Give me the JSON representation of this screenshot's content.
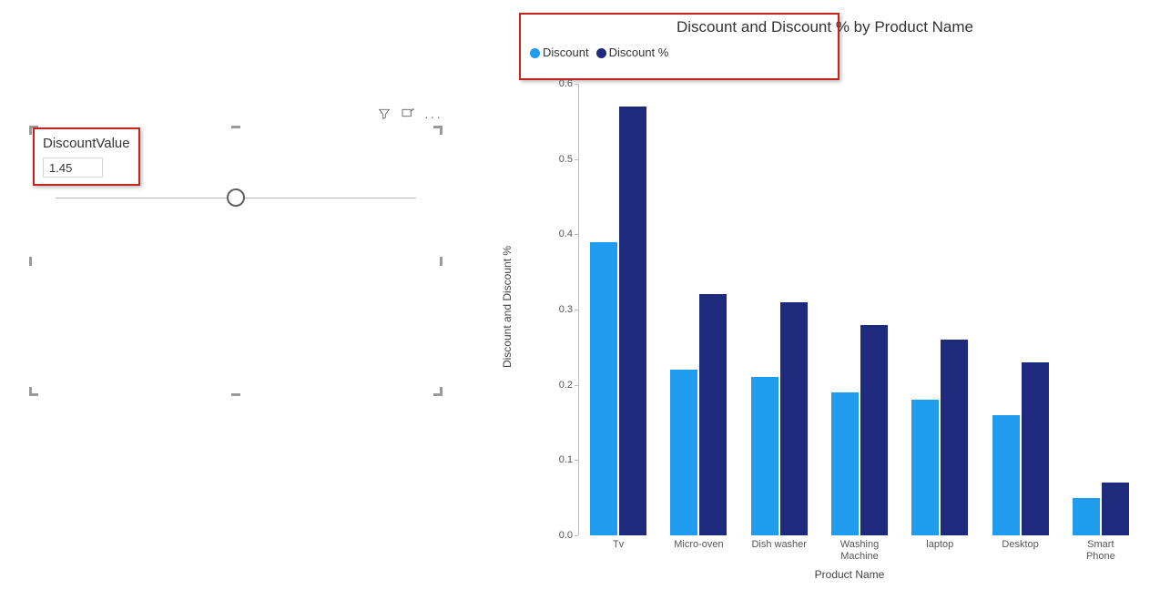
{
  "slicer": {
    "label": "DiscountValue",
    "value": "1.45"
  },
  "chart_data": {
    "type": "bar",
    "title": "Discount and Discount % by Product Name",
    "xlabel": "Product Name",
    "ylabel": "Discount and Discount %",
    "ylim": [
      0,
      0.6
    ],
    "yticks": [
      0.0,
      0.1,
      0.2,
      0.3,
      0.4,
      0.5,
      0.6
    ],
    "categories": [
      "Tv",
      "Micro-oven",
      "Dish washer",
      "Washing\nMachine",
      "laptop",
      "Desktop",
      "Smart Phone"
    ],
    "series": [
      {
        "name": "Discount",
        "color": "#1f9ced",
        "values": [
          0.39,
          0.22,
          0.21,
          0.19,
          0.18,
          0.16,
          0.05
        ]
      },
      {
        "name": "Discount %",
        "color": "#1e2a7b",
        "values": [
          0.57,
          0.32,
          0.31,
          0.28,
          0.26,
          0.23,
          0.07
        ]
      }
    ]
  }
}
